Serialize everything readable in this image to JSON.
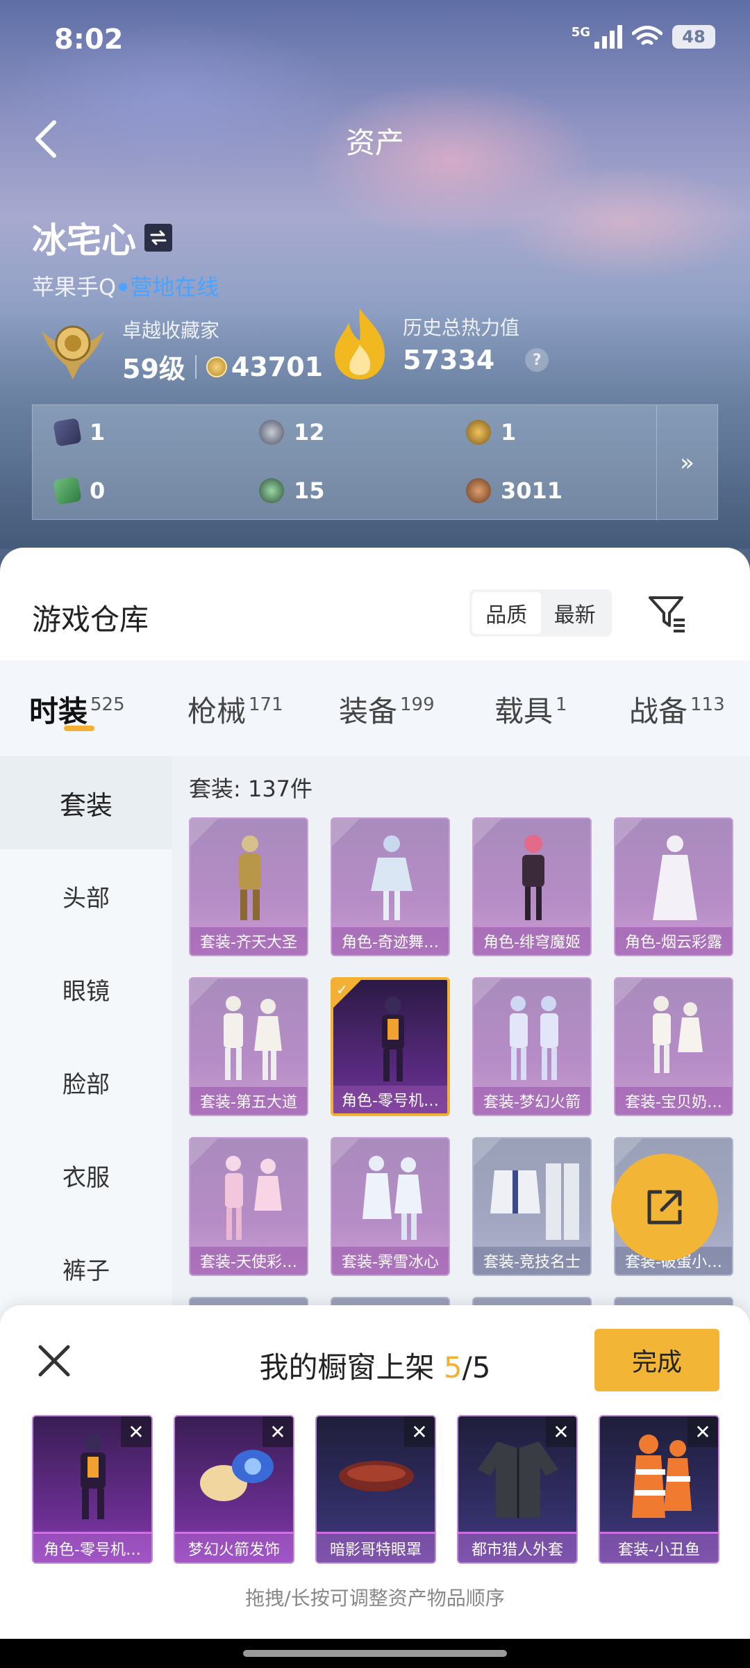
{
  "status": {
    "time": "8:02",
    "network": "5G",
    "battery": "48"
  },
  "nav": {
    "title": "资产"
  },
  "profile": {
    "name": "冰宅心",
    "platform": "苹果手Q",
    "online_status": "营地在线"
  },
  "stats": {
    "collector_title": "卓越收藏家",
    "collector_level": "59级",
    "collector_points": "43701",
    "heat_label": "历史总热力值",
    "heat_value": "57334",
    "help": "?"
  },
  "resources": [
    {
      "icon": "purple-card-icon",
      "value": "1"
    },
    {
      "icon": "silver-coin-icon",
      "value": "12"
    },
    {
      "icon": "gold-badge-icon",
      "value": "1"
    },
    {
      "icon": "green-ticket-icon",
      "value": "0"
    },
    {
      "icon": "green-orb-icon",
      "value": "15"
    },
    {
      "icon": "bronze-coin-icon",
      "value": "3011"
    }
  ],
  "resources_more": "»",
  "warehouse": {
    "title": "游戏仓库",
    "sort_options": [
      "品质",
      "最新"
    ],
    "active_sort": "品质"
  },
  "tabs": [
    {
      "label": "时装",
      "count": "525",
      "active": true
    },
    {
      "label": "枪械",
      "count": "171"
    },
    {
      "label": "装备",
      "count": "199"
    },
    {
      "label": "载具",
      "count": "1"
    },
    {
      "label": "战备",
      "count": "113"
    }
  ],
  "sidebar": [
    "套装",
    "头部",
    "眼镜",
    "脸部",
    "衣服",
    "裤子"
  ],
  "content": {
    "count_label": "套装: 137件",
    "items": [
      {
        "label": "套装-齐天大圣"
      },
      {
        "label": "角色-奇迹舞…"
      },
      {
        "label": "角色-绯穹魔姬"
      },
      {
        "label": "角色-烟云彩露"
      },
      {
        "label": "套装-第五大道"
      },
      {
        "label": "角色-零号机…",
        "selected": true
      },
      {
        "label": "套装-梦幻火箭"
      },
      {
        "label": "套装-宝贝奶…"
      },
      {
        "label": "套装-天使彩…"
      },
      {
        "label": "套装-霁雪冰心"
      },
      {
        "label": "套装-竞技名士"
      },
      {
        "label": "套装-破蛋小…"
      }
    ]
  },
  "showcase": {
    "title_prefix": "我的橱窗上架",
    "current": "5",
    "total": "/5",
    "done_label": "完成",
    "slots": [
      {
        "label": "角色-零号机…"
      },
      {
        "label": "梦幻火箭发饰"
      },
      {
        "label": "暗影哥特眼罩"
      },
      {
        "label": "都市猎人外套"
      },
      {
        "label": "套装-小丑鱼"
      }
    ],
    "hint": "拖拽/长按可调整资产物品顺序"
  },
  "colors": {
    "accent": "#f2b134",
    "online": "#4aa3ff",
    "card_purple": "#b68cc6"
  }
}
